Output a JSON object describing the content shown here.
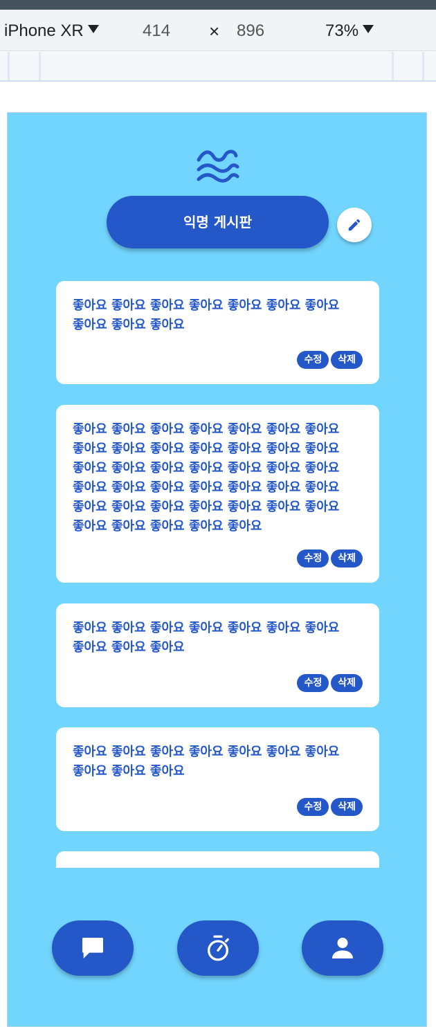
{
  "devtools": {
    "device_name": "iPhone XR",
    "width": "414",
    "times": "×",
    "height": "896",
    "zoom": "73%"
  },
  "header": {
    "title": "익명 게시판",
    "logo_icon": "waves-icon",
    "write_icon": "pencil-icon"
  },
  "posts": [
    {
      "content": "좋아요 좋아요 좋아요 좋아요 좋아요 좋아요 좋아요 좋아요 좋아요 좋아요",
      "edit_label": "수정",
      "delete_label": "삭제"
    },
    {
      "content": "좋아요 좋아요 좋아요 좋아요 좋아요 좋아요 좋아요 좋아요 좋아요 좋아요 좋아요 좋아요 좋아요 좋아요 좋아요 좋아요 좋아요 좋아요 좋아요 좋아요 좋아요 좋아요 좋아요 좋아요 좋아요 좋아요 좋아요 좋아요 좋아요 좋아요 좋아요 좋아요 좋아요 좋아요 좋아요 좋아요 좋아요 좋아요 좋아요 좋아요",
      "edit_label": "수정",
      "delete_label": "삭제"
    },
    {
      "content": "좋아요 좋아요 좋아요 좋아요 좋아요 좋아요 좋아요 좋아요 좋아요 좋아요",
      "edit_label": "수정",
      "delete_label": "삭제"
    },
    {
      "content": "좋아요 좋아요 좋아요 좋아요 좋아요 좋아요 좋아요 좋아요 좋아요 좋아요",
      "edit_label": "수정",
      "delete_label": "삭제"
    },
    {
      "content": "",
      "edit_label": "",
      "delete_label": ""
    }
  ],
  "nav": {
    "items": [
      {
        "icon": "chat-icon"
      },
      {
        "icon": "stopwatch-icon"
      },
      {
        "icon": "user-icon"
      }
    ]
  },
  "colors": {
    "background": "#72d5fd",
    "accent": "#2457c8",
    "card": "#ffffff"
  }
}
